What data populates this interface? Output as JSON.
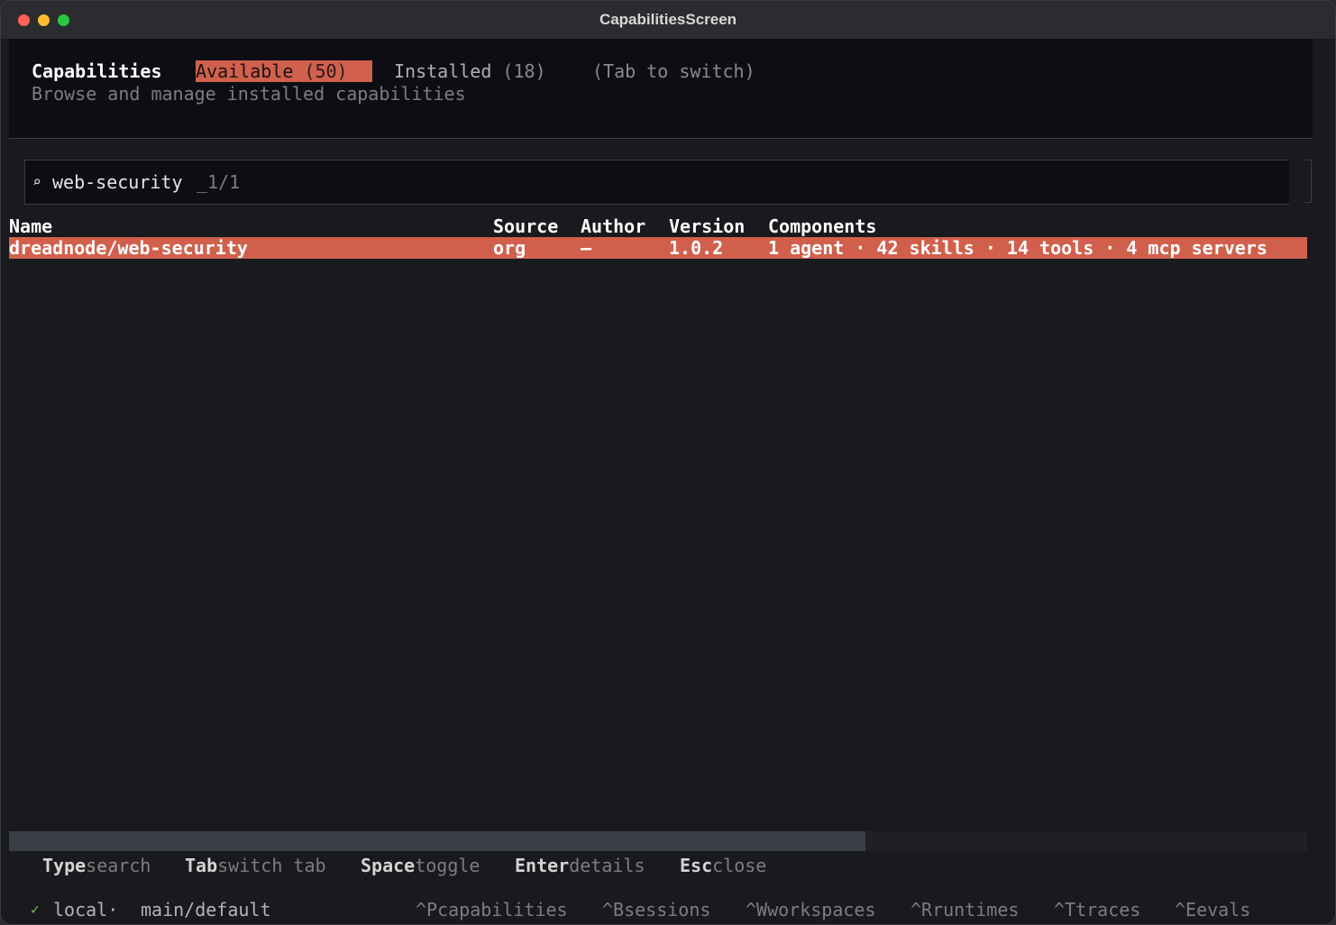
{
  "window": {
    "title": "CapabilitiesScreen"
  },
  "header": {
    "title": "Capabilities",
    "subtitle": "Browse and manage installed capabilities",
    "tabs": [
      {
        "label": "Available",
        "count": "(50)",
        "active": true
      },
      {
        "label": "Installed",
        "count": "(18)",
        "active": false
      }
    ],
    "tab_hint": "(Tab to switch)"
  },
  "search": {
    "icon": "search-icon",
    "value": "web-security",
    "cursor": "_",
    "match_count": "1/1"
  },
  "table": {
    "columns": [
      "Name",
      "Source",
      "Author",
      "Version",
      "Components"
    ],
    "rows": [
      {
        "name": "dreadnode/web-security",
        "source": "org",
        "author": "–",
        "version": "1.0.2",
        "components": "1 agent · 42 skills · 14 tools · 4 mcp servers",
        "selected": true
      }
    ]
  },
  "keybindings": [
    {
      "key": "Type",
      "desc": "search"
    },
    {
      "key": "Tab",
      "desc": "switch tab"
    },
    {
      "key": "Space",
      "desc": "toggle"
    },
    {
      "key": "Enter",
      "desc": "details"
    },
    {
      "key": "Esc",
      "desc": "close"
    }
  ],
  "statusbar": {
    "check": "✓",
    "connection": "local·",
    "workspace": "main/default",
    "nav": [
      {
        "label": "^Pcapabilities"
      },
      {
        "label": "^Bsessions"
      },
      {
        "label": "^Wworkspaces"
      },
      {
        "label": "^Rruntimes"
      },
      {
        "label": "^Ttraces"
      },
      {
        "label": "^Eevals"
      }
    ]
  },
  "colors": {
    "accent": "#d0604c",
    "background": "#181a1e",
    "header_background": "#0c0e13",
    "status_ok": "#7fc35a"
  }
}
